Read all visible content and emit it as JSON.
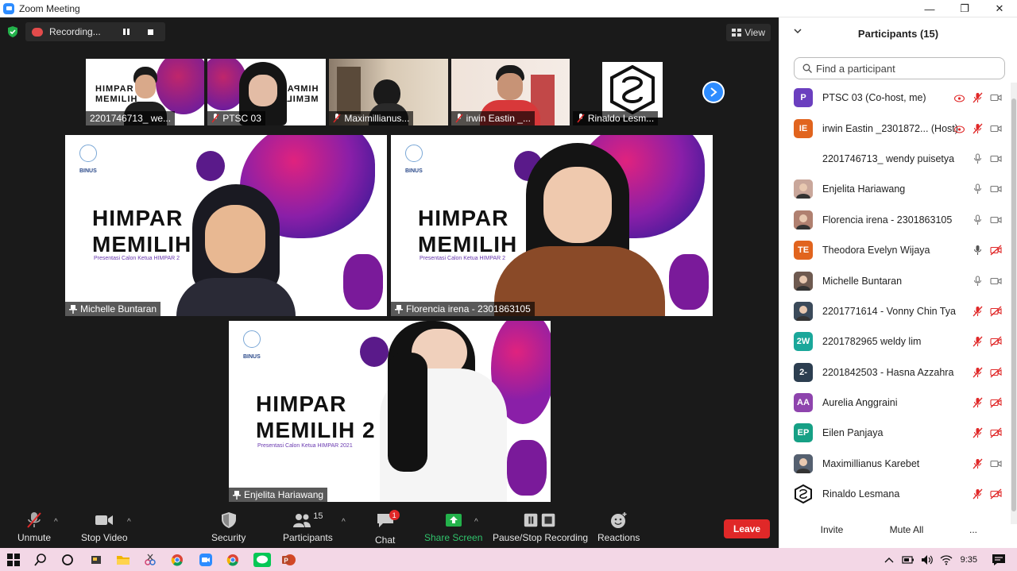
{
  "window": {
    "title": "Zoom Meeting"
  },
  "recording": {
    "label": "Recording..."
  },
  "view": {
    "label": "View"
  },
  "thumbnails": [
    {
      "name": "2201746713_ we..."
    },
    {
      "name": "PTSC 03"
    },
    {
      "name": "Maximillianus..."
    },
    {
      "name": "irwin Eastin _..."
    },
    {
      "name": "Rinaldo Lesm..."
    }
  ],
  "slide": {
    "line1": "HIMPAR",
    "line2": "MEMILIH",
    "line2_bottom": "MEMILIH 2",
    "subtitle": "Presentasi Calon Ketua HIMPAR 2021",
    "subtitle_short": "Presentasi Calon Ketua HIMPAR 2",
    "logo_text": "BINUS",
    "thumb_line1": "HIMPAR",
    "thumb_line2": "MEMILIH",
    "mirror_line1": "HIMPAR",
    "mirror_line2": "MEMILIH"
  },
  "tiles": [
    {
      "name": "Michelle Buntaran"
    },
    {
      "name": "Florencia irena - 2301863105"
    },
    {
      "name": "Enjelita Hariawang"
    }
  ],
  "toolbar": {
    "unmute": "Unmute",
    "stop_video": "Stop Video",
    "security": "Security",
    "participants": "Participants",
    "participants_count": "15",
    "chat": "Chat",
    "chat_badge": "1",
    "share_screen": "Share Screen",
    "pause_stop_recording": "Pause/Stop Recording",
    "reactions": "Reactions",
    "leave": "Leave"
  },
  "panel": {
    "title": "Participants (15)",
    "search_placeholder": "Find a participant",
    "participants": [
      {
        "name": "PTSC 03 (Co-host, me)",
        "initials": "P",
        "color": "#6b3fbf",
        "mic": "muted",
        "video": "on",
        "recording": true
      },
      {
        "name": "irwin Eastin _2301872... (Host)",
        "initials": "IE",
        "color": "#e1641e",
        "mic": "muted",
        "video": "on",
        "recording": true
      },
      {
        "name": "2201746713_ wendy puisetya",
        "initials": "",
        "color": "#ffffff",
        "mic": "on",
        "video": "on",
        "recording": false
      },
      {
        "name": "Enjelita Hariawang",
        "initials": "",
        "color": "#c9a79b",
        "mic": "on",
        "video": "on",
        "recording": false
      },
      {
        "name": "Florencia irena - 2301863105",
        "initials": "",
        "color": "#b08070",
        "mic": "on",
        "video": "on",
        "recording": false
      },
      {
        "name": "Theodora Evelyn Wijaya",
        "initials": "TE",
        "color": "#e1641e",
        "mic": "active",
        "video": "off",
        "recording": false
      },
      {
        "name": "Michelle Buntaran",
        "initials": "",
        "color": "#6e5a50",
        "mic": "on",
        "video": "on",
        "recording": false
      },
      {
        "name": "2201771614 - Vonny Chin Tya",
        "initials": "",
        "color": "#3b4a5a",
        "mic": "muted",
        "video": "off",
        "recording": false
      },
      {
        "name": "2201782965 weldy lim",
        "initials": "2W",
        "color": "#1aa79a",
        "mic": "muted",
        "video": "off",
        "recording": false
      },
      {
        "name": "2201842503 - Hasna Azzahra",
        "initials": "2-",
        "color": "#2c3e50",
        "mic": "muted",
        "video": "off",
        "recording": false
      },
      {
        "name": "Aurelia Anggraini",
        "initials": "AA",
        "color": "#8e44ad",
        "mic": "muted",
        "video": "off",
        "recording": false
      },
      {
        "name": "Eilen Panjaya",
        "initials": "EP",
        "color": "#16a085",
        "mic": "muted",
        "video": "off",
        "recording": false
      },
      {
        "name": "Maximillianus Karebet",
        "initials": "",
        "color": "#556070",
        "mic": "muted",
        "video": "on",
        "recording": false
      },
      {
        "name": "Rinaldo Lesmana",
        "initials": "",
        "color": "#ffffff",
        "mic": "muted",
        "video": "off",
        "recording": false
      }
    ],
    "invite": "Invite",
    "mute_all": "Mute All",
    "more": "..."
  },
  "taskbar": {
    "time": "9:35"
  }
}
